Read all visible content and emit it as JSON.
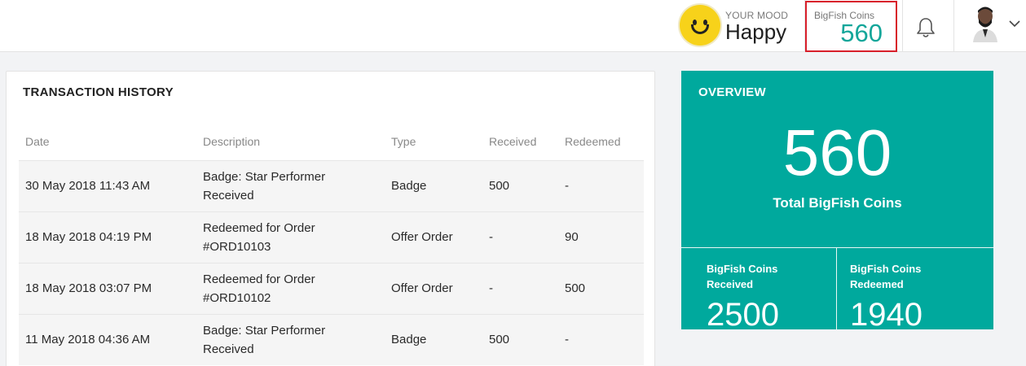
{
  "header": {
    "mood": {
      "label": "YOUR MOOD",
      "value": "Happy",
      "icon": "smiley-face-icon"
    },
    "coins": {
      "label": "BigFish Coins",
      "value": "560",
      "highlight_color": "#d81f2a"
    },
    "icons": [
      "bell-icon",
      "avatar",
      "chevron-down-icon"
    ]
  },
  "transactions": {
    "title": "TRANSACTION HISTORY",
    "columns": [
      "Date",
      "Description",
      "Type",
      "Received",
      "Redeemed"
    ],
    "rows": [
      {
        "date": "30 May 2018 11:43 AM",
        "desc1": "Badge: Star Performer",
        "desc2": "Received",
        "type": "Badge",
        "received": "500",
        "redeemed": "-"
      },
      {
        "date": "18 May 2018 04:19 PM",
        "desc1": "Redeemed for Order",
        "desc2": "#ORD10103",
        "type": "Offer Order",
        "received": "-",
        "redeemed": "90"
      },
      {
        "date": "18 May 2018 03:07 PM",
        "desc1": "Redeemed for Order",
        "desc2": "#ORD10102",
        "type": "Offer Order",
        "received": "-",
        "redeemed": "500"
      },
      {
        "date": "11 May 2018 04:36 AM",
        "desc1": "Badge: Star Performer",
        "desc2": "Received",
        "type": "Badge",
        "received": "500",
        "redeemed": "-"
      }
    ]
  },
  "overview": {
    "title": "OVERVIEW",
    "total": "560",
    "total_label": "Total BigFish Coins",
    "received_label": "BigFish Coins Received",
    "received_value": "2500",
    "redeemed_label": "BigFish Coins Redeemed",
    "redeemed_value": "1940",
    "accent_color": "#00a99d"
  }
}
